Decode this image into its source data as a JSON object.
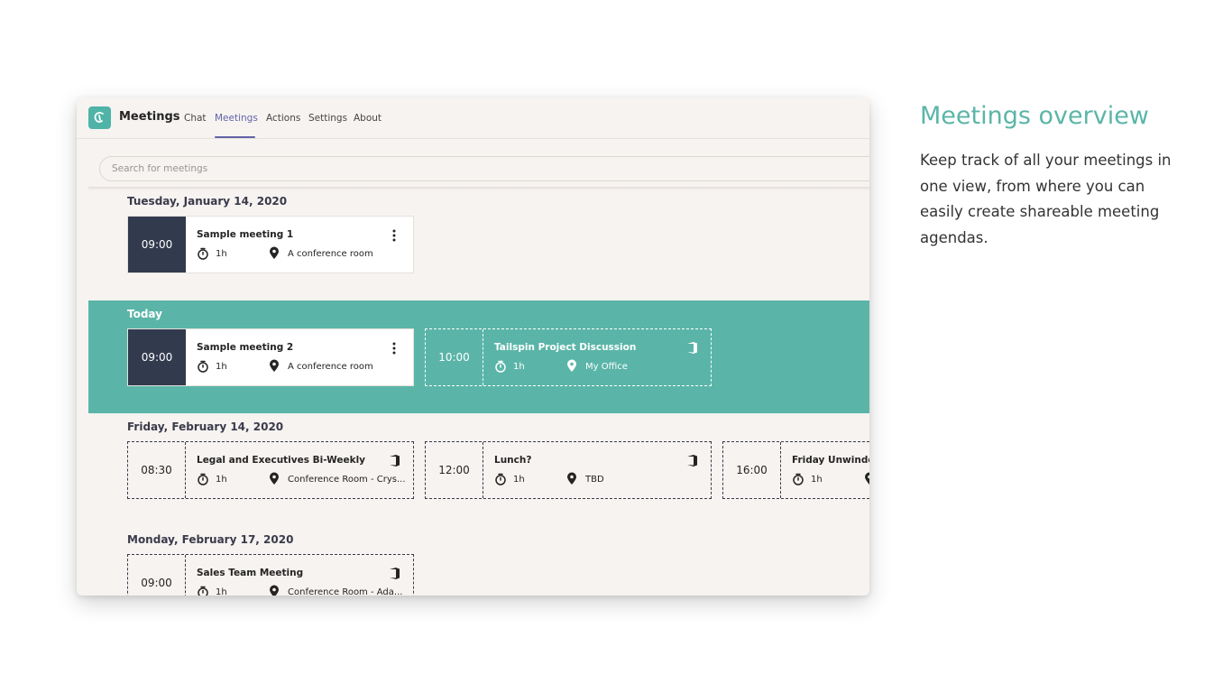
{
  "app": {
    "title": "Meetings",
    "logo_icon": "teams-app-logo-icon",
    "accent": "#5ab5a8",
    "tab_accent": "#6264a7"
  },
  "nav": {
    "tabs": [
      {
        "label": "Chat",
        "active": false
      },
      {
        "label": "Meetings",
        "active": true
      },
      {
        "label": "Actions",
        "active": false
      },
      {
        "label": "Settings",
        "active": false
      },
      {
        "label": "About",
        "active": false
      }
    ]
  },
  "search": {
    "placeholder": "Search for meetings"
  },
  "days": [
    {
      "label": "Tuesday, January 14, 2020",
      "meetings": [
        {
          "time": "09:00",
          "title": "Sample meeting 1",
          "duration": "1h",
          "location": "A conference room",
          "icon": "more-vertical-icon"
        }
      ]
    },
    {
      "label": "Today",
      "meetings": [
        {
          "time": "09:00",
          "title": "Sample meeting 2",
          "duration": "1h",
          "location": "A conference room",
          "icon": "more-vertical-icon"
        },
        {
          "time": "10:00",
          "title": "Tailspin Project Discussion",
          "duration": "1h",
          "location": "My Office",
          "icon": "office-icon"
        }
      ]
    },
    {
      "label": "Friday, February 14, 2020",
      "meetings": [
        {
          "time": "08:30",
          "title": "Legal and Executives Bi-Weekly",
          "duration": "1h",
          "location": "Conference Room - Crys...",
          "icon": "office-icon"
        },
        {
          "time": "12:00",
          "title": "Lunch?",
          "duration": "1h",
          "location": "TBD",
          "icon": "office-icon"
        },
        {
          "time": "16:00",
          "title": "Friday Unwinde",
          "duration": "1h",
          "location": "",
          "icon": "office-icon"
        }
      ]
    },
    {
      "label": "Monday, February 17, 2020",
      "meetings": [
        {
          "time": "09:00",
          "title": "Sales Team Meeting",
          "duration": "1h",
          "location": "Conference Room - Ada...",
          "icon": "office-icon"
        }
      ]
    }
  ],
  "side": {
    "title": "Meetings overview",
    "description": "Keep track of all your meetings in one view, from where you can easily create shareable meeting agendas."
  }
}
